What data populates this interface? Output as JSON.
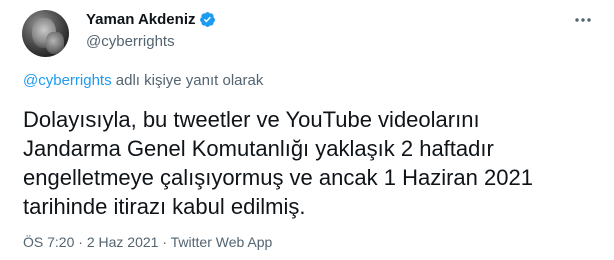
{
  "author": {
    "display_name": "Yaman Akdeniz",
    "handle": "@cyberrights",
    "verified_badge_color": "#1d9bf0"
  },
  "reply_context": {
    "mention": "@cyberrights",
    "suffix": " adlı kişiye yanıt olarak"
  },
  "tweet": {
    "text": "Dolayısıyla, bu tweetler ve YouTube videolarını\nJandarma Genel Komutanlığı yaklaşık 2 haftadır\nengelletmeye çalışıyormuş ve ancak 1 Haziran 2021\ntarihinde itirazı kabul edilmiş."
  },
  "meta": {
    "time": "ÖS 7:20",
    "separator1": " · ",
    "date": "2 Haz 2021",
    "separator2": " · ",
    "source": "Twitter Web App"
  },
  "icons": {
    "more": "more-options-icon",
    "verified": "verified-badge-icon"
  },
  "colors": {
    "link": "#1d9bf0",
    "secondary_text": "#536471",
    "primary_text": "#0f1419"
  }
}
